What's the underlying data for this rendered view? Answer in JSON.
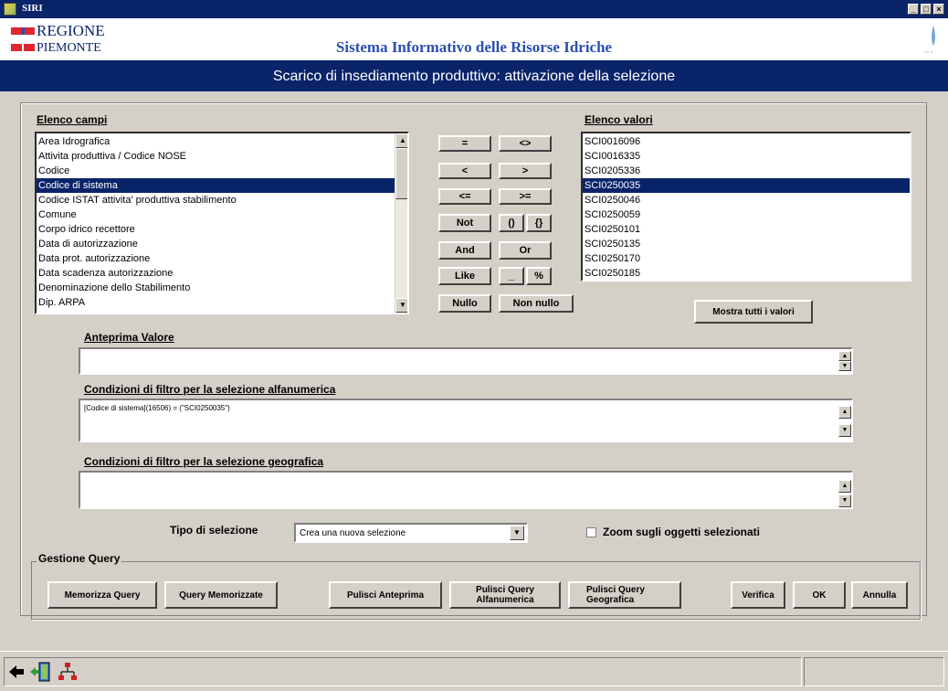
{
  "window": {
    "title": "SIRI",
    "controls": [
      "_",
      "□",
      "×"
    ]
  },
  "header": {
    "logo_line1": "REGIONE",
    "logo_line2": "PIEMONTE",
    "app_title": "Sistema Informativo delle Risorse Idriche",
    "subtitle": "Scarico di insediamento produttivo: attivazione della selezione",
    "colors": {
      "brand_blue": "#0a246a",
      "flag_red": "#e1262d"
    }
  },
  "fields": {
    "label": "Elenco campi",
    "items": [
      "Area Idrografica",
      "Attivita produttiva / Codice NOSE",
      "Codice",
      "Codice di sistema",
      "Codice ISTAT attivita' produttiva stabilimento",
      "Comune",
      "Corpo idrico recettore",
      "Data di autorizzazione",
      "Data prot. autorizzazione",
      "Data scadenza autorizzazione",
      "Denominazione dello Stabilimento",
      "Dip. ARPA"
    ],
    "selected_index": 3
  },
  "operators": {
    "eq": "=",
    "neq": "<>",
    "lt": "<",
    "gt": ">",
    "le": "<=",
    "ge": ">=",
    "not": "Not",
    "paren": "()",
    "brace": "{}",
    "and": "And",
    "or": "Or",
    "like": "Like",
    "underscore": "_",
    "percent": "%",
    "null": "Nullo",
    "not_null": "Non nullo"
  },
  "values": {
    "label": "Elenco valori",
    "items": [
      "SCI0016096",
      "SCI0016335",
      "SCI0205336",
      "SCI0250035",
      "SCI0250046",
      "SCI0250059",
      "SCI0250101",
      "SCI0250135",
      "SCI0250170",
      "SCI0250185"
    ],
    "selected_index": 3,
    "show_all_button": "Mostra tutti i valori"
  },
  "preview": {
    "label": "Anteprima Valore",
    "value": ""
  },
  "alpha_filter": {
    "label": "Condizioni di filtro per la selezione alfanumerica",
    "value": "[Codice di sistema](16506) = (\"SCI0250035\")"
  },
  "geo_filter": {
    "label": "Condizioni di filtro per la selezione geografica",
    "value": ""
  },
  "selection": {
    "label": "Tipo di selezione",
    "value": "Crea una nuova selezione",
    "zoom_label": "Zoom sugli oggetti selezionati",
    "zoom_checked": false
  },
  "query": {
    "group_label": "Gestione Query",
    "save": "Memorizza Query",
    "saved": "Query Memorizzate",
    "clear_preview": "Pulisci Anteprima",
    "clear_alpha_1": "Pulisci Query",
    "clear_alpha_2": "Alfanumerica",
    "clear_geo_1": "Pulisci Query",
    "clear_geo_2": "Geografica",
    "verify": "Verifica",
    "ok": "OK",
    "cancel": "Annulla"
  },
  "statusbar": {
    "icons": [
      "back-arrow-icon",
      "exit-door-icon",
      "network-tree-icon"
    ]
  }
}
